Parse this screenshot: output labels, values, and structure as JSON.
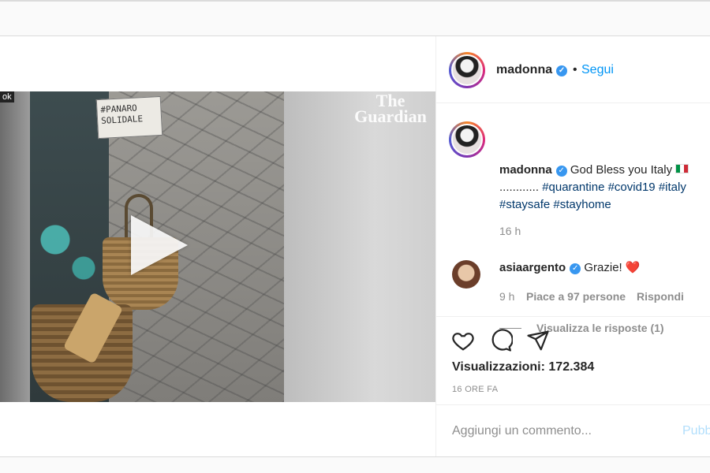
{
  "post": {
    "media": {
      "watermark": "The Guardian",
      "corner_tag": "ok",
      "sign_text": "#PANARO SOLIDALE",
      "play_icon": "play-icon"
    },
    "header": {
      "username": "madonna",
      "verified": true,
      "separator": "•",
      "follow_label": "Segui"
    },
    "caption": {
      "username": "madonna",
      "text": "God Bless you Italy",
      "flag": "🇮🇹",
      "dots": "............",
      "hashtags": [
        "#quarantine",
        "#covid19",
        "#italy",
        "#staysafe",
        "#stayhome"
      ],
      "time": "16 h"
    },
    "comment": {
      "username": "asiaargento",
      "text": "Grazie!",
      "heart": "❤️",
      "time": "9 h",
      "likes": "Piace a 97 persone",
      "reply": "Rispondi",
      "view_replies": "Visualizza le risposte (1)"
    },
    "actions": {
      "icons": [
        "heart-icon",
        "comment-icon",
        "share-icon"
      ],
      "views_label": "Visualizzazioni:",
      "views_value": "172.384",
      "posted_ago": "16 ORE FA"
    },
    "add_comment": {
      "placeholder": "Aggiungi un commento...",
      "publish_label": "Pubb"
    }
  },
  "colors": {
    "link": "#0095f6",
    "hashtag": "#00376b",
    "muted": "#8e8e8e",
    "verified": "#3897f0"
  }
}
